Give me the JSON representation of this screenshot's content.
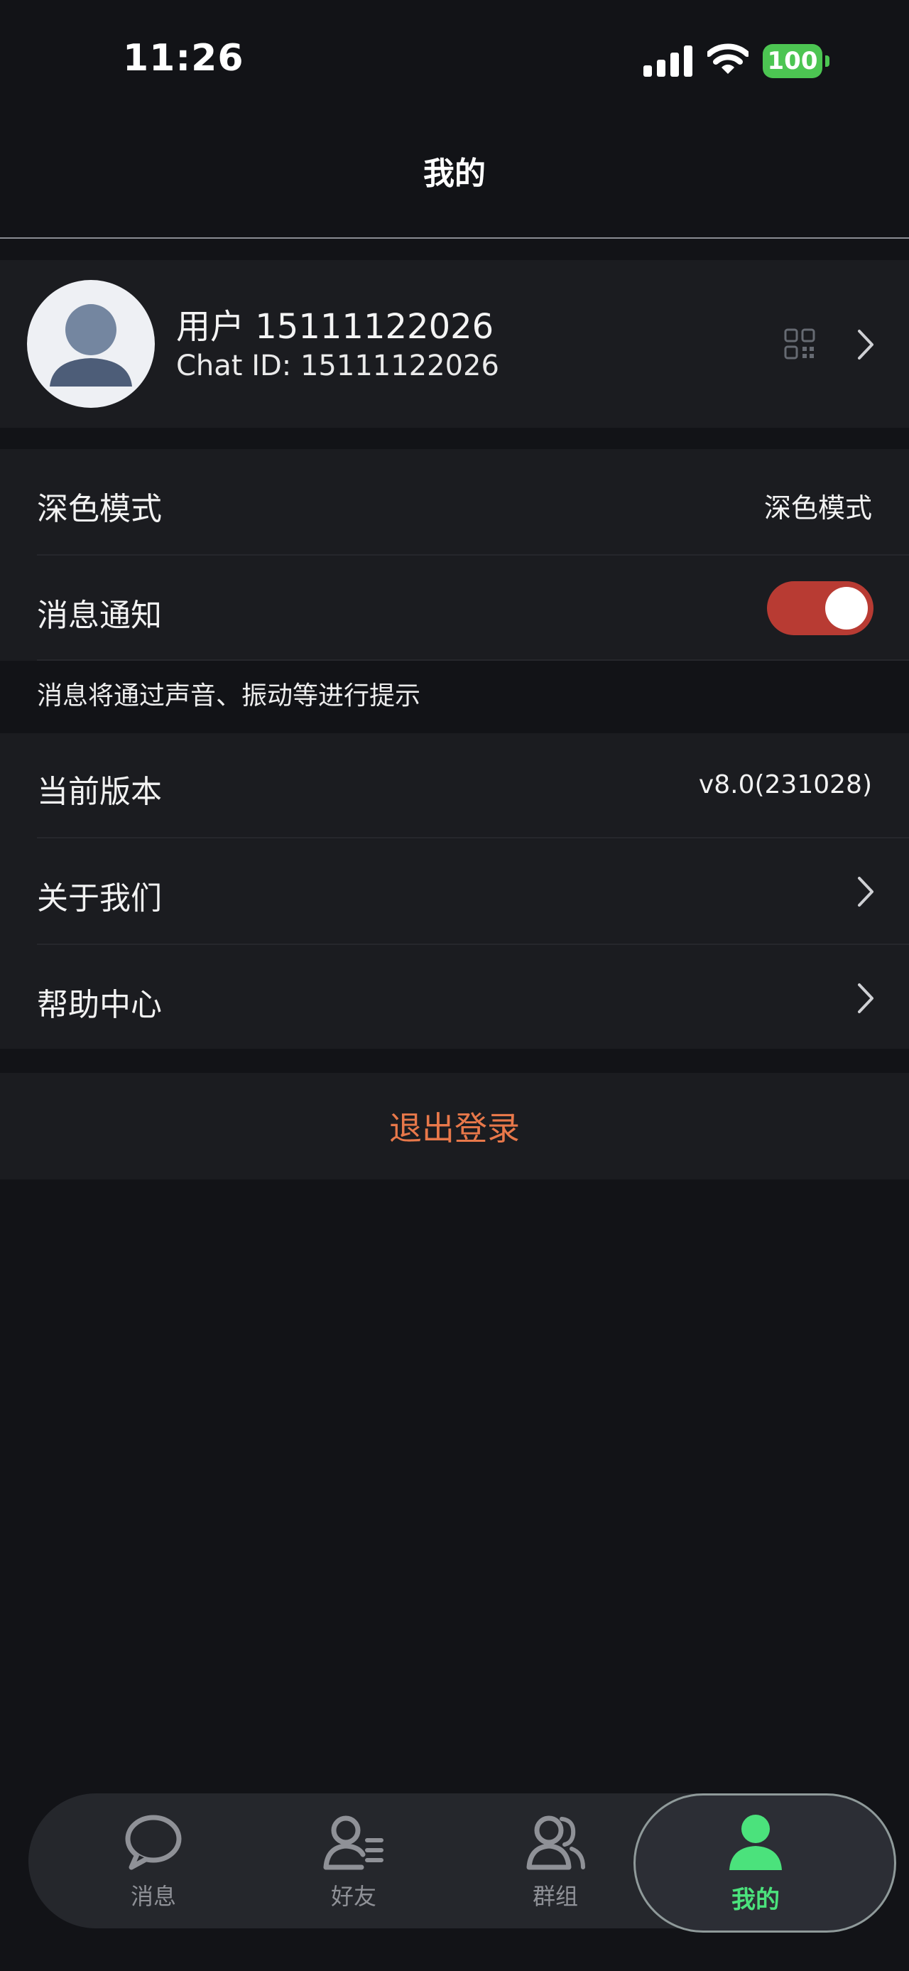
{
  "status_bar": {
    "time": "11:26",
    "battery": "100",
    "battery_color": "#4cc552"
  },
  "header": {
    "title": "我的"
  },
  "profile": {
    "name": "用户 15111122026",
    "chat_id": "Chat ID: 15111122026",
    "qr_icon": "qr-code-icon"
  },
  "settings": {
    "dark_mode": {
      "label": "深色模式",
      "value": "深色模式"
    },
    "notifications": {
      "label": "消息通知",
      "enabled": true,
      "hint": "消息将通过声音、振动等进行提示"
    },
    "version": {
      "label": "当前版本",
      "value": "v8.0(231028)"
    },
    "about": {
      "label": "关于我们"
    },
    "help": {
      "label": "帮助中心"
    }
  },
  "logout": {
    "label": "退出登录",
    "color": "#e8784a"
  },
  "tabs": [
    {
      "label": "消息",
      "icon": "chat-bubble-icon",
      "active": false
    },
    {
      "label": "好友",
      "icon": "friends-icon",
      "active": false
    },
    {
      "label": "群组",
      "icon": "group-icon",
      "active": false
    },
    {
      "label": "我的",
      "icon": "me-icon",
      "active": true
    }
  ],
  "colors": {
    "background": "#121317",
    "panel": "#1b1c20",
    "toggle_on": "#b83b33",
    "active_tab": "#4be27c"
  }
}
